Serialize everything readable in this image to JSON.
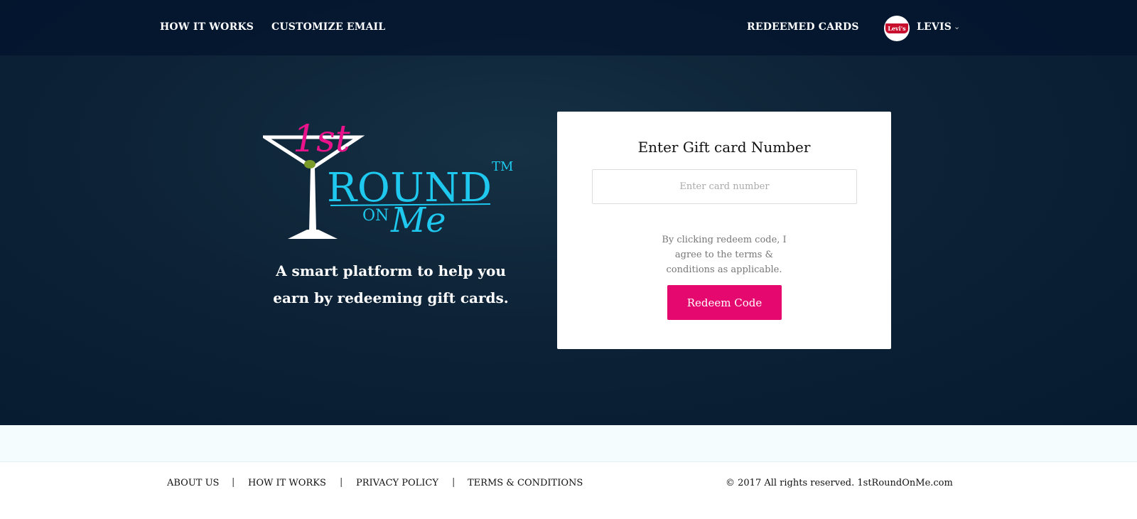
{
  "nav": {
    "how_it_works": "HOW IT WORKS",
    "customize_email": "CUSTOMIZE EMAIL",
    "redeemed_cards": "REDEEMED CARDS",
    "user": "LEVIS",
    "user_logo_text": "Levi's"
  },
  "logo": {
    "first": "1st",
    "round": "ROUND",
    "tm": "TM",
    "on": "ON",
    "me": "Me"
  },
  "hero": {
    "tagline_line1": "A smart platform to help you",
    "tagline_line2": "earn by redeeming gift cards."
  },
  "card": {
    "title": "Enter Gift card Number",
    "input_placeholder": "Enter card number",
    "input_value": "",
    "terms": "By clicking redeem code, I agree to the terms & conditions as applicable.",
    "button": "Redeem Code"
  },
  "footer": {
    "links": [
      "ABOUT US",
      "HOW IT WORKS",
      "PRIVACY POLICY",
      "TERMS & CONDITIONS"
    ],
    "separator": "|",
    "copyright": "© 2017 All rights reserved. 1stRoundOnMe.com"
  },
  "colors": {
    "accent": "#e5096f",
    "cyan": "#1ec8ee",
    "navy": "#061a30"
  }
}
